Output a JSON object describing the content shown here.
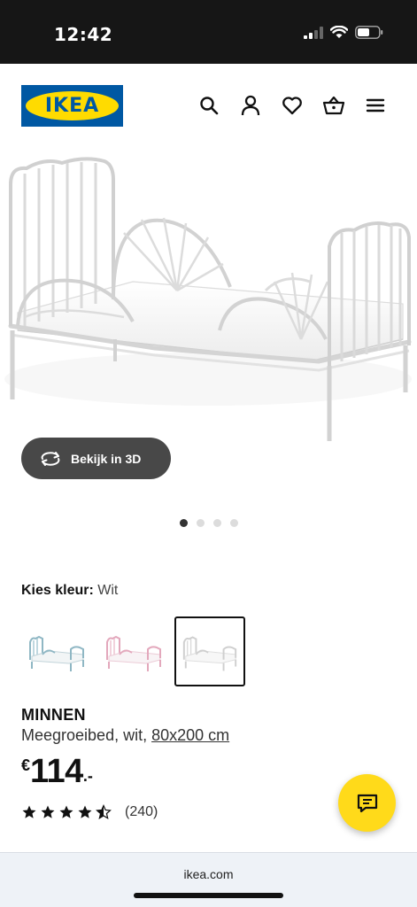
{
  "status_bar": {
    "time": "12:42"
  },
  "header": {
    "logo_text": "IKEA",
    "icons": [
      "search-icon",
      "account-icon",
      "wishlist-heart-icon",
      "basket-icon",
      "menu-icon"
    ]
  },
  "gallery": {
    "view_3d_label": "Bekijk in 3D",
    "slide_count": 4,
    "active_slide": 1
  },
  "color_picker": {
    "label": "Kies kleur:",
    "selected_value": "Wit",
    "swatches": [
      {
        "color": "light blue",
        "selected": false
      },
      {
        "color": "pink",
        "selected": false
      },
      {
        "color": "white",
        "selected": true
      }
    ]
  },
  "product": {
    "name": "MINNEN",
    "description": "Meegroeibed, wit, ",
    "size": "80x200 cm",
    "price": {
      "currency": "€",
      "amount": "114",
      "suffix": ".-"
    },
    "rating": {
      "stars": 4.5,
      "max_stars": 5,
      "count_text": "(240)"
    }
  },
  "browser": {
    "url": "ikea.com"
  },
  "colors": {
    "ikea_blue": "#0058a3",
    "ikea_yellow": "#ffdb00",
    "chat_yellow": "#ffda1a",
    "button_dark": "#484848"
  }
}
